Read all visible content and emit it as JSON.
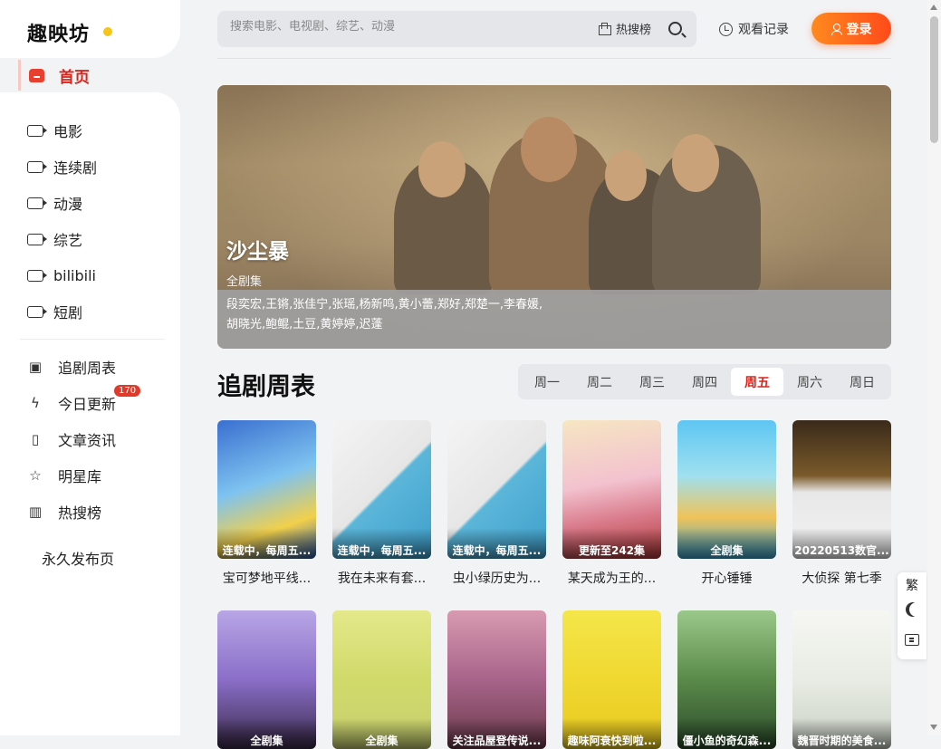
{
  "brand": {
    "logo": "趣映坊",
    "accent": "#d9251c",
    "dot_color": "#f5c518"
  },
  "sidebar": {
    "home": {
      "label": "首页",
      "icon": "tv-icon"
    },
    "categories": [
      {
        "label": "电影",
        "icon": "video-icon"
      },
      {
        "label": "连续剧",
        "icon": "video-icon"
      },
      {
        "label": "动漫",
        "icon": "video-icon"
      },
      {
        "label": "综艺",
        "icon": "video-icon"
      },
      {
        "label": "bilibili",
        "icon": "video-icon"
      },
      {
        "label": "短剧",
        "icon": "video-icon"
      }
    ],
    "tools": [
      {
        "label": "追剧周表",
        "icon": "calendar-icon"
      },
      {
        "label": "今日更新",
        "icon": "lightning-icon",
        "badge": "170"
      },
      {
        "label": "文章资讯",
        "icon": "book-icon"
      },
      {
        "label": "明星库",
        "icon": "star-icon"
      },
      {
        "label": "热搜榜",
        "icon": "chart-icon"
      }
    ],
    "permanent": "永久发布页"
  },
  "header": {
    "search_placeholder": "搜索电影、电视剧、综艺、动漫",
    "hot_label": "热搜榜",
    "history_label": "观看记录",
    "login_label": "登录"
  },
  "banner": {
    "title": "沙尘暴",
    "subtitle": "全剧集",
    "cast": "段奕宏,王锵,张佳宁,张瑶,杨新鸣,黄小蕾,郑好,郑楚一,李春媛,胡晓光,鲍鲲,土豆,黄婷婷,迟蓬"
  },
  "schedule": {
    "title": "追剧周表",
    "days": [
      "周一",
      "周二",
      "周三",
      "周四",
      "周五",
      "周六",
      "周日"
    ],
    "active_index": 4
  },
  "row1": [
    {
      "label": "连载中，每周五...",
      "title": "宝可梦地平线..."
    },
    {
      "label": "连载中，每周五...",
      "title": "我在未来有套..."
    },
    {
      "label": "连载中，每周五...",
      "title": "虫小绿历史为..."
    },
    {
      "label": "更新至242集",
      "title": "某天成为王的..."
    },
    {
      "label": "全剧集",
      "title": "开心锤锤"
    },
    {
      "label": "20220513数官...",
      "title": "大侦探 第七季"
    }
  ],
  "row2": [
    {
      "label": "全剧集",
      "title": ""
    },
    {
      "label": "全剧集",
      "title": ""
    },
    {
      "label": "关注品屋登传说...",
      "title": ""
    },
    {
      "label": "趣味阿衰快到啦...",
      "title": ""
    },
    {
      "label": "僵小鱼的奇幻森...",
      "title": ""
    },
    {
      "label": "魏晋时期的美食...",
      "title": ""
    }
  ],
  "float": {
    "traditional": "繁",
    "icons": [
      "moon-icon",
      "feedback-icon"
    ]
  }
}
